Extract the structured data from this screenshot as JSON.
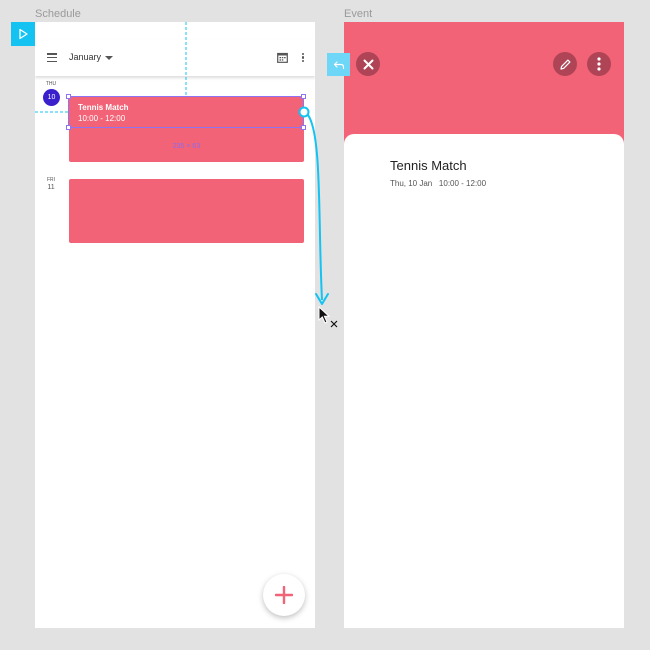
{
  "artboards": {
    "schedule_label": "Schedule",
    "event_label": "Event"
  },
  "schedule": {
    "month": "January",
    "days": [
      {
        "name": "THU",
        "number": "10",
        "selected": true
      },
      {
        "name": "FRI",
        "number": "11",
        "selected": false
      }
    ],
    "events": [
      {
        "title": "Tennis Match",
        "time": "10:00 - 12:00"
      }
    ],
    "selection_size": "235 × 63"
  },
  "event_detail": {
    "title": "Tennis Match",
    "date": "Thu, 10 Jan",
    "time": "10:00 - 12:00"
  },
  "icons": {
    "prototype_start": "play-icon",
    "menu": "hamburger-icon",
    "calendar": "calendar-icon",
    "overflow": "kebab-icon",
    "add": "plus-icon",
    "close": "close-icon",
    "edit": "pencil-icon",
    "back": "back-arrow-icon"
  },
  "colors": {
    "accent_pink": "#f26377",
    "selected_day": "#3a1fcc",
    "prototype_link": "#14c3f2",
    "selection": "#8f73f0",
    "canvas": "#e2e2e2"
  }
}
